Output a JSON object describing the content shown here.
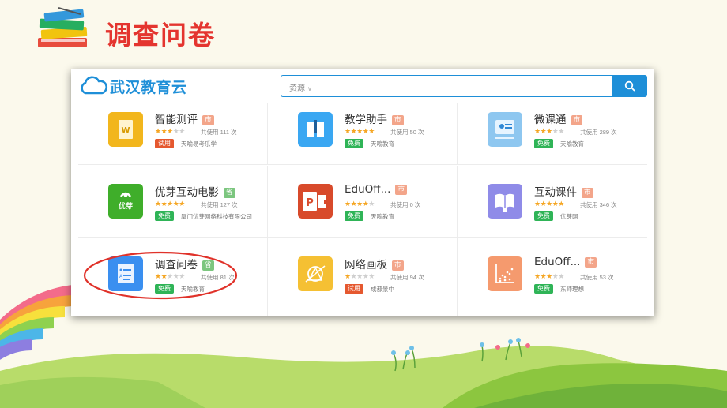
{
  "slide": {
    "title": "调查问卷",
    "title_color": "#e4352f",
    "decoration_icons": [
      "books-stack-icon",
      "rainbow-decoration",
      "grass-hill-decoration"
    ]
  },
  "header": {
    "logo_text": "武汉教育云",
    "logo_icon": "cloud-icon",
    "search_scope": "资源",
    "search_placeholder": "",
    "search_button_icon": "search-icon",
    "accent": "#1e8fd8"
  },
  "apps": [
    {
      "name": "智能测评",
      "level": "市",
      "stars": 3,
      "usage": "共使用 111 次",
      "price": "试用",
      "provider": "天喻易考乐学",
      "icon": "smart-assessment-icon",
      "icon_color": "#f2b61c"
    },
    {
      "name": "教学助手",
      "level": "市",
      "stars": 5,
      "usage": "共使用 50 次",
      "price": "免费",
      "provider": "天喻教育",
      "icon": "teaching-assistant-icon",
      "icon_color": "#3aa7f2"
    },
    {
      "name": "微课通",
      "level": "市",
      "stars": 3,
      "usage": "共使用 289 次",
      "price": "免费",
      "provider": "天喻教育",
      "icon": "micro-course-icon",
      "icon_color": "#8ec7f0"
    },
    {
      "name": "优芽互动电影",
      "level": "省",
      "stars": 5,
      "usage": "共使用 127 次",
      "price": "免费",
      "provider": "厦门优芽网络科技有限公司",
      "icon": "youya-icon",
      "icon_color": "#3fae2a"
    },
    {
      "name": "EduOff...",
      "level": "市",
      "stars": 4,
      "usage": "共使用 0 次",
      "price": "免费",
      "provider": "天喻教育",
      "icon": "powerpoint-icon",
      "icon_color": "#d84a2b"
    },
    {
      "name": "互动课件",
      "level": "市",
      "stars": 5,
      "usage": "共使用 346 次",
      "price": "免费",
      "provider": "优芽网",
      "icon": "interactive-courseware-icon",
      "icon_color": "#8f8be8"
    },
    {
      "name": "调查问卷",
      "level": "省",
      "stars": 2,
      "usage": "共使用 81 次",
      "price": "免费",
      "provider": "天喻教育",
      "icon": "survey-icon",
      "icon_color": "#3a8ff0"
    },
    {
      "name": "网络画板",
      "level": "市",
      "stars": 1,
      "usage": "共使用 94 次",
      "price": "试用",
      "provider": "成都景中",
      "icon": "geometry-board-icon",
      "icon_color": "#f5c033"
    },
    {
      "name": "EduOff...",
      "level": "市",
      "stars": 3,
      "usage": "共使用 53 次",
      "price": "免费",
      "provider": "东师理想",
      "icon": "chart-app-icon",
      "icon_color": "#f59a6e"
    }
  ],
  "colors": {
    "level_city": "#f3a58a",
    "level_province": "#7cc67f",
    "price_free": "#2fb457",
    "price_trial": "#e5582f",
    "highlight": "#e0322a"
  }
}
